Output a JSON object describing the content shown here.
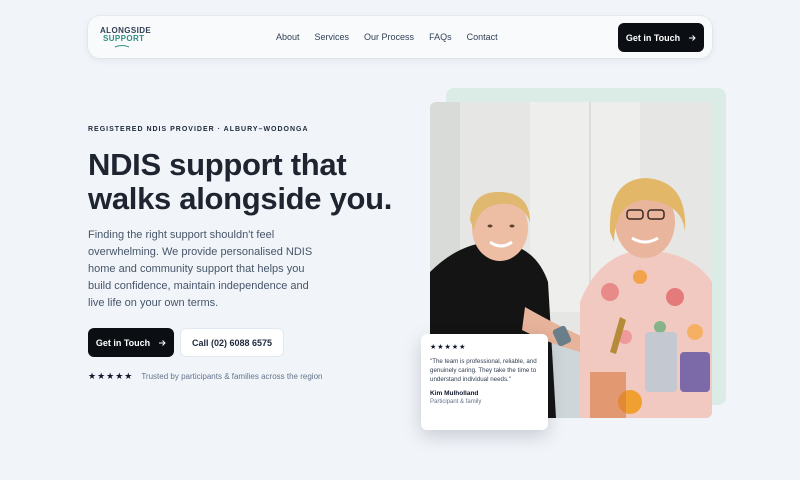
{
  "brand": {
    "line1": "ALONGSIDE",
    "line2": "SUPPORT"
  },
  "nav": {
    "links": [
      "About",
      "Services",
      "Our Process",
      "FAQs",
      "Contact"
    ],
    "cta": "Get in Touch"
  },
  "hero": {
    "eyebrow": "REGISTERED NDIS PROVIDER · ALBURY–WODONGA",
    "headline_line1": "NDIS support that",
    "headline_line2": "walks alongside you.",
    "lede": "Finding the right support shouldn't feel overwhelming. We provide personalised NDIS home and community support that helps you build confidence, maintain independence and live life on your own terms.",
    "primary_cta": "Get in Touch",
    "secondary_cta": "Call (02) 6088 6575",
    "trust_stars": "★★★★★",
    "trust_text": "Trusted by participants & families across the region"
  },
  "review": {
    "stars": "★★★★★",
    "quote": "\"The team is professional, reliable, and genuinely caring. They take the time to understand individual needs.\"",
    "name": "Kim Mulholland",
    "role": "Participant & family"
  },
  "colors": {
    "accent": "#2f8f83",
    "dark": "#0b0f14",
    "photo_backdrop": "#dbece6"
  }
}
